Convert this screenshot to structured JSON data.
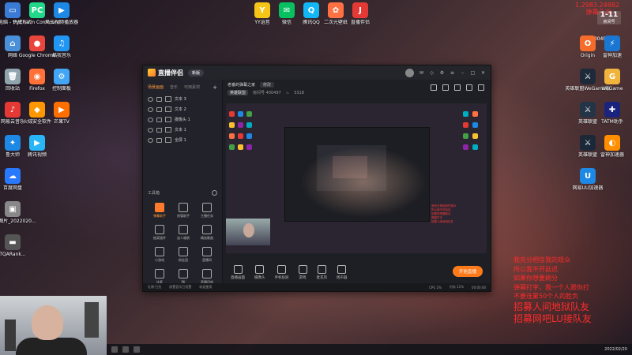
{
  "desktop_left": [
    {
      "label": "此电脑 - 快捷方式",
      "color": "#3a7bd5",
      "glyph": "▭"
    },
    {
      "label": "PyCharm Community",
      "color": "#21d789",
      "glyph": "PC"
    },
    {
      "label": "风云视频播放器",
      "color": "#1e88e5",
      "glyph": "▶"
    },
    {
      "label": "网络",
      "color": "#4a90d9",
      "glyph": "⌂"
    },
    {
      "label": "Google Chrome",
      "color": "#e8453c",
      "glyph": "●"
    },
    {
      "label": "酷我音乐",
      "color": "#2196f3",
      "glyph": "♫"
    },
    {
      "label": "回收站",
      "color": "#90a4ae",
      "glyph": "🗑"
    },
    {
      "label": "Firefox",
      "color": "#ff7139",
      "glyph": "◉"
    },
    {
      "label": "控制面板",
      "color": "#42a5f5",
      "glyph": "⚙"
    },
    {
      "label": "网易云音乐",
      "color": "#e53935",
      "glyph": "♪"
    },
    {
      "label": "火绒安全软件",
      "color": "#ff9800",
      "glyph": "◆"
    },
    {
      "label": "芒果TV",
      "color": "#ff6f00",
      "glyph": "▶"
    },
    {
      "label": "鲁大师",
      "color": "#1e88e5",
      "glyph": "✦"
    },
    {
      "label": "腾讯视频",
      "color": "#29b6f6",
      "glyph": "▶"
    },
    {
      "label": "百度网盘",
      "color": "#2979ff",
      "glyph": "☁"
    },
    {
      "label": "微信图片_2022020...",
      "color": "#888888",
      "glyph": "▣"
    },
    {
      "label": "TQARank...",
      "color": "#555555",
      "glyph": "▬"
    }
  ],
  "desktop_top": [
    {
      "label": "YY语音",
      "color": "#f5c518",
      "glyph": "Y"
    },
    {
      "label": "微信",
      "color": "#07c160",
      "glyph": "✉"
    },
    {
      "label": "腾讯QQ",
      "color": "#12b7f5",
      "glyph": "Q"
    },
    {
      "label": "二次元壁纸",
      "color": "#ff7043",
      "glyph": "✿"
    },
    {
      "label": "直播伴侣",
      "color": "#e53935",
      "glyph": "J"
    }
  ],
  "desktop_right": [
    {
      "label": "Origin",
      "color": "#f56c2d",
      "glyph": "O"
    },
    {
      "label": "雷神加速",
      "color": "#1976d2",
      "glyph": "⚡"
    },
    {
      "label": "英雄联盟WeGame版",
      "color": "#1e2a3a",
      "glyph": "⚔"
    },
    {
      "label": "WeGame",
      "color": "#f0b43c",
      "glyph": "G"
    },
    {
      "label": "英雄联盟",
      "color": "#243447",
      "glyph": "⚔"
    },
    {
      "label": "TATM助手",
      "color": "#1a237e",
      "glyph": "✚"
    },
    {
      "label": "英雄联盟",
      "color": "#1b2838",
      "glyph": "⚔"
    },
    {
      "label": "雷神加速器",
      "color": "#ff8f00",
      "glyph": "◐"
    },
    {
      "label": "网易UU加速器",
      "color": "#1e88e5",
      "glyph": "U"
    }
  ],
  "app": {
    "name": "直播伴侣",
    "version_tag": "新版",
    "left_tabs": [
      "场景画面",
      "音乐",
      "可用素材"
    ],
    "scenes": [
      "文本 3",
      "文本 2",
      "摄像头 1",
      "文本 1",
      "全屏 1"
    ],
    "tools_title": "工具箱",
    "tools": [
      "弹幕助手",
      "房管助手",
      "主播任务",
      "抽奖插件",
      "送人福袋",
      "精选歌曲",
      "小游戏",
      "粉丝团",
      "直播间",
      "连麦",
      "PK",
      "直播回放"
    ],
    "room_title": "老番的弹幕之家",
    "edit_label": "修改",
    "room_category": "英雄联盟",
    "room_id_label": "房间号 400497",
    "online_count": "5318",
    "toolbar": [
      "直播画面",
      "摄像头",
      "手机投屏",
      "游戏",
      "麦克风",
      "扬声器"
    ],
    "start_live": "开始直播",
    "status": [
      "礼物·已拉",
      "前置音乐已设置",
      "欢迎使用",
      "CPU 2%",
      "内存 11%",
      "00:00:00"
    ]
  },
  "overlay": {
    "top_lines": [
      "1.2983.24882",
      "弹幕几次 …"
    ],
    "room_badge_top": "1-11",
    "room_badge_label": "房间号",
    "room_number": "400497",
    "rules": [
      "我充分相信我的观众",
      "所以我不开延迟",
      "如果你想要刷分",
      "弹幕打字，我一个人跟你打",
      "不要连累50个人的胜负"
    ],
    "rules_big": [
      "招募人间地狱队友",
      "招募网吧LU接队友"
    ],
    "preview_red": [
      "我充分相信我的观众",
      "所以我不开延迟",
      "如果你想要刷分",
      "弹幕打字",
      "招募人间地狱队友"
    ]
  },
  "taskbar": {
    "clock": "2022/02/20"
  }
}
